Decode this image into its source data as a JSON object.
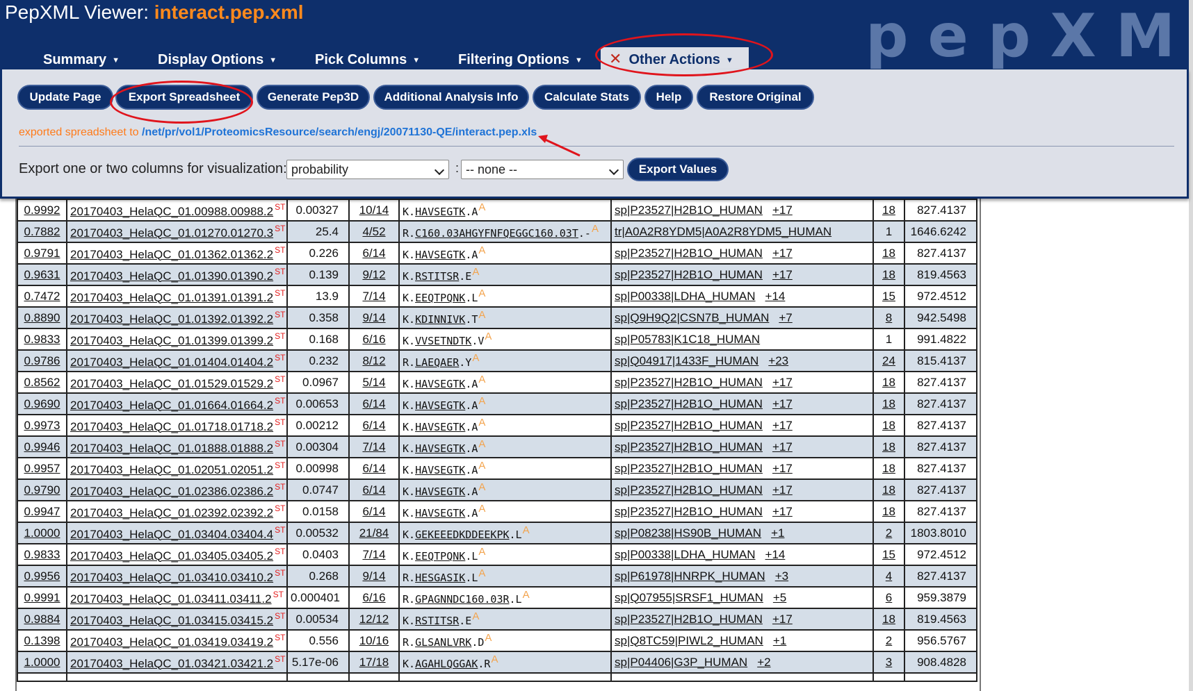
{
  "header": {
    "title_prefix": "PepXML Viewer:",
    "title_file": "interact.pep.xml",
    "logo": "pepXML"
  },
  "menu": [
    {
      "label": "Summary",
      "active": false
    },
    {
      "label": "Display Options",
      "active": false
    },
    {
      "label": "Pick Columns",
      "active": false
    },
    {
      "label": "Filtering Options",
      "active": false
    },
    {
      "label": "Other Actions",
      "active": true,
      "icon": "close-x-icon"
    }
  ],
  "panel": {
    "buttons": [
      "Update Page",
      "Export Spreadsheet",
      "Generate Pep3D",
      "Additional Analysis Info",
      "Calculate Stats",
      "Help",
      "Restore Original"
    ],
    "export_msg_prefix": "exported spreadsheet to",
    "export_path": "/net/pr/vol1/ProteomicsResource/search/engj/20071130-QE/interact.pep.xls",
    "viz_label": "Export one or two columns for visualization:",
    "select1": "probability",
    "select2": "-- none --",
    "select_separator": ":",
    "export_values_label": "Export Values"
  },
  "colors": {
    "header_bg": "#0e2f6b",
    "panel_bg": "#dde0e8",
    "file_orange": "#ff8a1d",
    "annotation_red": "#e0141c",
    "row_alt": "#d5dee8"
  },
  "table": {
    "rows": [
      {
        "prob": "0.9992",
        "spectrum": "20170403_HelaQC_01.00988.00988.2",
        "expect": "0.00327",
        "ions": "10/14",
        "pep_pre": "K.",
        "pep_seq": "HAVSEGTK",
        "pep_post": ".A",
        "protein": "sp|P23527|H2B1O_HUMAN",
        "extra": "+17",
        "num": "18",
        "mass": "827.4137"
      },
      {
        "prob": "0.7882",
        "spectrum": "20170403_HelaQC_01.01270.01270.3",
        "expect": "25.4",
        "ions": "4/52",
        "pep_pre": "R.",
        "pep_seq": "C160.03AHGYFNFQEGGC160.03T",
        "pep_post": ".-",
        "protein": "tr|A0A2R8YDM5|A0A2R8YDM5_HUMAN",
        "extra": "",
        "num": "1",
        "mass": "1646.6242"
      },
      {
        "prob": "0.9791",
        "spectrum": "20170403_HelaQC_01.01362.01362.2",
        "expect": "0.226",
        "ions": "6/14",
        "pep_pre": "K.",
        "pep_seq": "HAVSEGTK",
        "pep_post": ".A",
        "protein": "sp|P23527|H2B1O_HUMAN",
        "extra": "+17",
        "num": "18",
        "mass": "827.4137"
      },
      {
        "prob": "0.9631",
        "spectrum": "20170403_HelaQC_01.01390.01390.2",
        "expect": "0.139",
        "ions": "9/12",
        "pep_pre": "K.",
        "pep_seq": "RSTITSR",
        "pep_post": ".E",
        "protein": "sp|P23527|H2B1O_HUMAN",
        "extra": "+17",
        "num": "18",
        "mass": "819.4563"
      },
      {
        "prob": "0.7472",
        "spectrum": "20170403_HelaQC_01.01391.01391.2",
        "expect": "13.9",
        "ions": "7/14",
        "pep_pre": "K.",
        "pep_seq": "EEQTPQNK",
        "pep_post": ".L",
        "protein": "sp|P00338|LDHA_HUMAN",
        "extra": "+14",
        "num": "15",
        "mass": "972.4512"
      },
      {
        "prob": "0.8890",
        "spectrum": "20170403_HelaQC_01.01392.01392.2",
        "expect": "0.358",
        "ions": "9/14",
        "pep_pre": "K.",
        "pep_seq": "KDINNIVK",
        "pep_post": ".T",
        "protein": "sp|Q9H9Q2|CSN7B_HUMAN",
        "extra": "+7",
        "num": "8",
        "mass": "942.5498"
      },
      {
        "prob": "0.9833",
        "spectrum": "20170403_HelaQC_01.01399.01399.2",
        "expect": "0.168",
        "ions": "6/16",
        "pep_pre": "K.",
        "pep_seq": "VVSETNDTK",
        "pep_post": ".V",
        "protein": "sp|P05783|K1C18_HUMAN",
        "extra": "",
        "num": "1",
        "mass": "991.4822"
      },
      {
        "prob": "0.9786",
        "spectrum": "20170403_HelaQC_01.01404.01404.2",
        "expect": "0.232",
        "ions": "8/12",
        "pep_pre": "R.",
        "pep_seq": "LAEQAER",
        "pep_post": ".Y",
        "protein": "sp|Q04917|1433F_HUMAN",
        "extra": "+23",
        "num": "24",
        "mass": "815.4137"
      },
      {
        "prob": "0.8562",
        "spectrum": "20170403_HelaQC_01.01529.01529.2",
        "expect": "0.0967",
        "ions": "5/14",
        "pep_pre": "K.",
        "pep_seq": "HAVSEGTK",
        "pep_post": ".A",
        "protein": "sp|P23527|H2B1O_HUMAN",
        "extra": "+17",
        "num": "18",
        "mass": "827.4137"
      },
      {
        "prob": "0.9690",
        "spectrum": "20170403_HelaQC_01.01664.01664.2",
        "expect": "0.00653",
        "ions": "6/14",
        "pep_pre": "K.",
        "pep_seq": "HAVSEGTK",
        "pep_post": ".A",
        "protein": "sp|P23527|H2B1O_HUMAN",
        "extra": "+17",
        "num": "18",
        "mass": "827.4137"
      },
      {
        "prob": "0.9973",
        "spectrum": "20170403_HelaQC_01.01718.01718.2",
        "expect": "0.00212",
        "ions": "6/14",
        "pep_pre": "K.",
        "pep_seq": "HAVSEGTK",
        "pep_post": ".A",
        "protein": "sp|P23527|H2B1O_HUMAN",
        "extra": "+17",
        "num": "18",
        "mass": "827.4137"
      },
      {
        "prob": "0.9946",
        "spectrum": "20170403_HelaQC_01.01888.01888.2",
        "expect": "0.00304",
        "ions": "7/14",
        "pep_pre": "K.",
        "pep_seq": "HAVSEGTK",
        "pep_post": ".A",
        "protein": "sp|P23527|H2B1O_HUMAN",
        "extra": "+17",
        "num": "18",
        "mass": "827.4137"
      },
      {
        "prob": "0.9957",
        "spectrum": "20170403_HelaQC_01.02051.02051.2",
        "expect": "0.00998",
        "ions": "6/14",
        "pep_pre": "K.",
        "pep_seq": "HAVSEGTK",
        "pep_post": ".A",
        "protein": "sp|P23527|H2B1O_HUMAN",
        "extra": "+17",
        "num": "18",
        "mass": "827.4137"
      },
      {
        "prob": "0.9790",
        "spectrum": "20170403_HelaQC_01.02386.02386.2",
        "expect": "0.0747",
        "ions": "6/14",
        "pep_pre": "K.",
        "pep_seq": "HAVSEGTK",
        "pep_post": ".A",
        "protein": "sp|P23527|H2B1O_HUMAN",
        "extra": "+17",
        "num": "18",
        "mass": "827.4137"
      },
      {
        "prob": "0.9947",
        "spectrum": "20170403_HelaQC_01.02392.02392.2",
        "expect": "0.0158",
        "ions": "6/14",
        "pep_pre": "K.",
        "pep_seq": "HAVSEGTK",
        "pep_post": ".A",
        "protein": "sp|P23527|H2B1O_HUMAN",
        "extra": "+17",
        "num": "18",
        "mass": "827.4137"
      },
      {
        "prob": "1.0000",
        "spectrum": "20170403_HelaQC_01.03404.03404.4",
        "expect": "0.00532",
        "ions": "21/84",
        "pep_pre": "K.",
        "pep_seq": "GEKEEEDKDDEEKPK",
        "pep_post": ".L",
        "protein": "sp|P08238|HS90B_HUMAN",
        "extra": "+1",
        "num": "2",
        "mass": "1803.8010"
      },
      {
        "prob": "0.9833",
        "spectrum": "20170403_HelaQC_01.03405.03405.2",
        "expect": "0.0403",
        "ions": "7/14",
        "pep_pre": "K.",
        "pep_seq": "EEQTPQNK",
        "pep_post": ".L",
        "protein": "sp|P00338|LDHA_HUMAN",
        "extra": "+14",
        "num": "15",
        "mass": "972.4512"
      },
      {
        "prob": "0.9956",
        "spectrum": "20170403_HelaQC_01.03410.03410.2",
        "expect": "0.268",
        "ions": "9/14",
        "pep_pre": "R.",
        "pep_seq": "HESGASIK",
        "pep_post": ".L",
        "protein": "sp|P61978|HNRPK_HUMAN",
        "extra": "+3",
        "num": "4",
        "mass": "827.4137"
      },
      {
        "prob": "0.9991",
        "spectrum": "20170403_HelaQC_01.03411.03411.2",
        "expect": "0.000401",
        "ions": "6/16",
        "pep_pre": "R.",
        "pep_seq": "GPAGNNDC160.03R",
        "pep_post": ".L",
        "protein": "sp|Q07955|SRSF1_HUMAN",
        "extra": "+5",
        "num": "6",
        "mass": "959.3879"
      },
      {
        "prob": "0.9884",
        "spectrum": "20170403_HelaQC_01.03415.03415.2",
        "expect": "0.00534",
        "ions": "12/12",
        "pep_pre": "K.",
        "pep_seq": "RSTITSR",
        "pep_post": ".E",
        "protein": "sp|P23527|H2B1O_HUMAN",
        "extra": "+17",
        "num": "18",
        "mass": "819.4563"
      },
      {
        "prob": "0.1398",
        "spectrum": "20170403_HelaQC_01.03419.03419.2",
        "expect": "0.556",
        "ions": "10/16",
        "pep_pre": "R.",
        "pep_seq": "GLSANLVRK",
        "pep_post": ".D",
        "protein": "sp|Q8TC59|PIWL2_HUMAN",
        "extra": "+1",
        "num": "2",
        "mass": "956.5767"
      },
      {
        "prob": "1.0000",
        "spectrum": "20170403_HelaQC_01.03421.03421.2",
        "expect": "5.17e-06",
        "ions": "17/18",
        "pep_pre": "K.",
        "pep_seq": "AGAHLQGGAK",
        "pep_post": ".R",
        "protein": "sp|P04406|G3P_HUMAN",
        "extra": "+2",
        "num": "3",
        "mass": "908.4828"
      }
    ],
    "superscript": "ST",
    "pep_icon": "A"
  }
}
